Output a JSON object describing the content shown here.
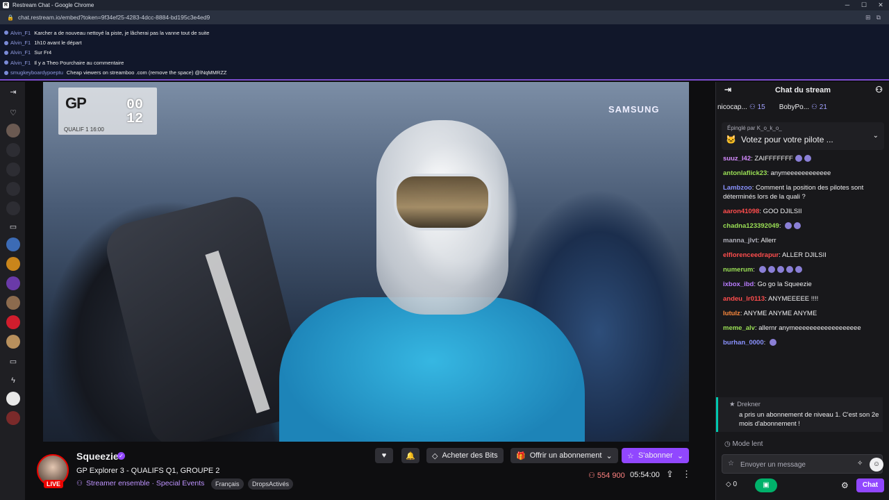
{
  "browser": {
    "window_title": "Restream Chat - Google Chrome",
    "url": "chat.restream.io/embed?token=9f34ef25-4283-4dcc-8884-bd195c3e4ed9"
  },
  "restream": {
    "messages": [
      {
        "user": "Alvin_F1",
        "text": "Karcher a de nouveau nettoyé la piste, je lâcherai pas la vanne tout de suite"
      },
      {
        "user": "Alvin_F1",
        "text": "1h10 avant le départ"
      },
      {
        "user": "Alvin_F1",
        "text": "Sur Fr4"
      },
      {
        "user": "Alvin_F1",
        "text": "Il y a Theo Pourchaire au commentaire"
      },
      {
        "user": "smugkeyboardypoeptu",
        "text": "Cheap viewers on streamboo .com (remove the space) @lNqMMRZZ"
      }
    ]
  },
  "video_overlay": {
    "gp_logo": "GP",
    "timer_min": "00",
    "timer_sec": "12",
    "session": "QUALIF 1  16:00",
    "sponsor": "SAMSUNG"
  },
  "stream": {
    "channel": "Squeezie",
    "live": "LIVE",
    "title": "GP Explorer 3 - QUALIFS Q1, GROUPE 2",
    "category": "Streamer ensemble · Special Events",
    "tags": [
      "Français",
      "DropsActivés"
    ],
    "buttons": {
      "bits": "Acheter des Bits",
      "gift": "Offrir un abonnement",
      "subscribe": "S'abonner"
    },
    "viewers": "554 900",
    "uptime": "05:54:00"
  },
  "chat": {
    "header": "Chat du stream",
    "gifts": [
      {
        "user": "nicocap...",
        "count": "15"
      },
      {
        "user": "BobyPo...",
        "count": "21"
      }
    ],
    "pinned_by": "Épinglé par K_o_k_o_",
    "pinned_title": "Votez pour votre pilote ...",
    "messages": [
      {
        "user": "suuz_l42",
        "color": "#d58bff",
        "text": "ZAIFFFFFFF"
      },
      {
        "user": "antonlaflick23",
        "color": "#9adf55",
        "text": "anymeeeeeeeeeeee"
      },
      {
        "user": "Lambzoo",
        "color": "#8a92ff",
        "text": "Comment la position des pilotes sont déterminés lors de la quali ?"
      },
      {
        "user": "aaron41098",
        "color": "#ff4d4d",
        "text": "GOO DJILSII"
      },
      {
        "user": "chadna123392049",
        "color": "#9adf55",
        "text": ""
      },
      {
        "user": "manna_jlvt",
        "color": "#adadb8",
        "text": "Allerr"
      },
      {
        "user": "elflorenceedrapur",
        "color": "#ff4d4d",
        "text": "ALLER DJILSII"
      },
      {
        "user": "numerum",
        "color": "#9adf55",
        "text": ""
      },
      {
        "user": "ixbox_ibd",
        "color": "#b97cff",
        "text": "Go go la Squeezie"
      },
      {
        "user": "andeu_lr0113",
        "color": "#ff4d4d",
        "text": "ANYMEEEEE !!!!"
      },
      {
        "user": "lutulz",
        "color": "#ff8a3d",
        "text": "ANYME ANYME ANYME"
      },
      {
        "user": "meme_alv",
        "color": "#9adf55",
        "text": "allernr anymeeeeeeeeeeeeeeeeee"
      },
      {
        "user": "burhan_0000",
        "color": "#8a92ff",
        "text": ""
      }
    ],
    "sub_card": {
      "user": "Drekner",
      "text": "a pris un abonnement de niveau 1. C'est son 2e mois d'abonnement !"
    },
    "slow_mode": "Mode lent",
    "input_placeholder": "Envoyer un message",
    "bits_count": "0",
    "send_label": "Chat"
  }
}
